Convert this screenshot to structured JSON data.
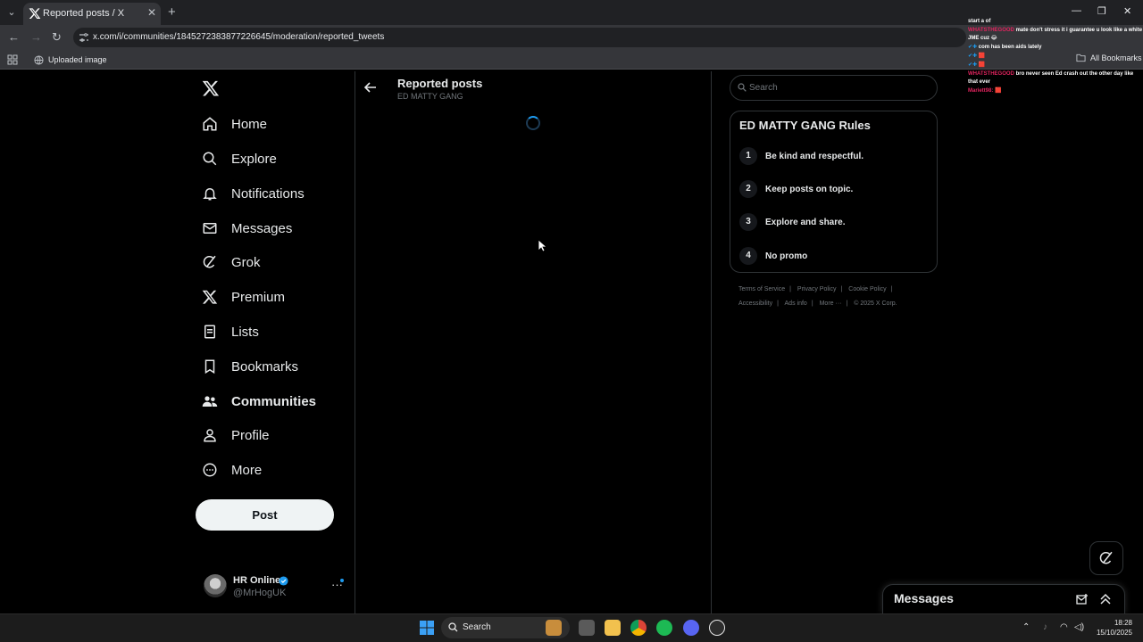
{
  "browser": {
    "tab_title": "Reported posts / X",
    "url": "x.com/i/communities/1845272383877226645/moderation/reported_tweets",
    "bookmark_item": "Uploaded image",
    "all_bookmarks": "All Bookmarks"
  },
  "nav": {
    "items": [
      {
        "label": "Home",
        "icon": "home-icon"
      },
      {
        "label": "Explore",
        "icon": "search-icon"
      },
      {
        "label": "Notifications",
        "icon": "bell-icon"
      },
      {
        "label": "Messages",
        "icon": "envelope-icon"
      },
      {
        "label": "Grok",
        "icon": "grok-icon"
      },
      {
        "label": "Premium",
        "icon": "x-logo-icon"
      },
      {
        "label": "Lists",
        "icon": "list-icon"
      },
      {
        "label": "Bookmarks",
        "icon": "bookmark-icon"
      },
      {
        "label": "Communities",
        "icon": "communities-icon",
        "active": true
      },
      {
        "label": "Profile",
        "icon": "person-icon"
      },
      {
        "label": "More",
        "icon": "more-circle-icon"
      }
    ],
    "post_label": "Post"
  },
  "account": {
    "name": "HR Online",
    "handle": "@MrHogUK",
    "more": "···"
  },
  "main": {
    "title": "Reported posts",
    "subtitle": "ED MATTY GANG"
  },
  "sidebar": {
    "search_placeholder": "Search",
    "rules_title": "ED MATTY GANG Rules",
    "rules": [
      {
        "num": "1",
        "text": "Be kind and respectful."
      },
      {
        "num": "2",
        "text": "Keep posts on topic."
      },
      {
        "num": "3",
        "text": "Explore and share."
      },
      {
        "num": "4",
        "text": "No promo"
      }
    ],
    "footer_row1": [
      "Terms of Service",
      "Privacy Policy",
      "Cookie Policy"
    ],
    "footer_row2": [
      "Accessibility",
      "Ads info",
      "More ···",
      "© 2025 X Corp."
    ]
  },
  "chat": [
    {
      "user": "",
      "msg": "start a of"
    },
    {
      "user": "WHATSTHEGOOD",
      "msg": "mate don't stress it i guarantee u look like a white JME cuz 😂"
    },
    {
      "user": "",
      "msg": "com has been aids lately"
    },
    {
      "user": "",
      "msg": "🟥"
    },
    {
      "user": "",
      "msg": "🟥"
    },
    {
      "user": "WHATSTHEGOOD",
      "msg": "bro never seen Ed crash out the other day like that ever"
    },
    {
      "user": "Mariett98:",
      "msg": "🟥"
    }
  ],
  "messages_drawer": {
    "title": "Messages"
  },
  "taskbar": {
    "search_label": "Search",
    "time": "18:28",
    "date": "15/10/2025"
  },
  "colors": {
    "accent": "#1d9bf0",
    "background": "#000000",
    "border": "#2f3336"
  }
}
